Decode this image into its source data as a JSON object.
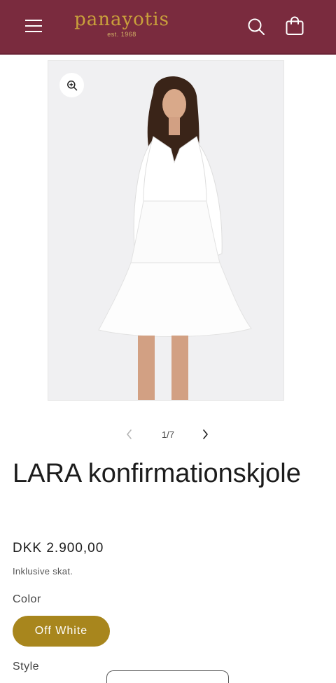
{
  "colors": {
    "header_bg": "#7a2b3e",
    "brand_gold": "#c9a03b",
    "swatch_bg": "#a8861d"
  },
  "header": {
    "menu_icon": "hamburger-icon",
    "brand_name": "panayotis",
    "brand_tagline": "est. 1968",
    "search_icon": "search-icon",
    "cart_icon": "cart-icon"
  },
  "gallery": {
    "zoom_icon": "zoom-in-icon",
    "image_subject": "woman in white tiered dress",
    "pager": {
      "prev_icon": "chevron-left-icon",
      "next_icon": "chevron-right-icon",
      "counter": "1/7"
    }
  },
  "product": {
    "title": "LARA konfirmationskjole",
    "price": "DKK 2.900,00",
    "tax_note": "Inklusive skat.",
    "color_label": "Color",
    "selected_color": "Off White",
    "style_label": "Style"
  }
}
